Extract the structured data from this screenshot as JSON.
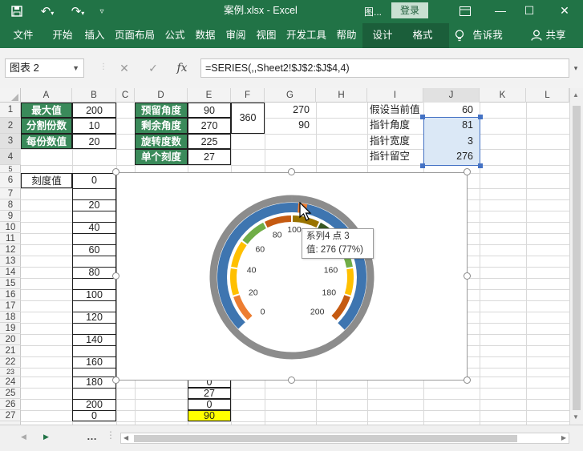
{
  "title_bar": {
    "document_title": "案例.xlsx  -  Excel",
    "picture_tools_tab": "图...",
    "login_label": "登录",
    "minimize_glyph": "—",
    "restore_glyph": "☐",
    "close_glyph": "✕"
  },
  "ribbon": {
    "tabs": [
      "文件",
      "开始",
      "插入",
      "页面布局",
      "公式",
      "数据",
      "审阅",
      "视图",
      "开发工具",
      "帮助"
    ],
    "context_tabs": [
      "设计",
      "格式"
    ],
    "tell_me": "告诉我",
    "share": "共享"
  },
  "formula_bar": {
    "name_box": "图表 2",
    "formula": "=SERIES(,,Sheet2!$J$2:$J$4,4)"
  },
  "columns": [
    "A",
    "B",
    "C",
    "D",
    "E",
    "F",
    "G",
    "H",
    "I",
    "J",
    "K",
    "L"
  ],
  "rows": [
    "1",
    "2",
    "3",
    "4",
    "5",
    "6",
    "7",
    "8",
    "9",
    "10",
    "11",
    "12",
    "13",
    "14",
    "15",
    "16",
    "17",
    "18",
    "19",
    "20",
    "21",
    "22",
    "23",
    "24",
    "25",
    "26",
    "27"
  ],
  "params": {
    "labels": [
      "最大值",
      "分割份数",
      "每份数值"
    ],
    "values": [
      "200",
      "10",
      "20"
    ]
  },
  "angles": {
    "labels": [
      "预留角度",
      "剩余角度",
      "旋转度数",
      "单个刻度"
    ],
    "values": [
      "90",
      "270",
      "225",
      "27"
    ]
  },
  "f1_value": "360",
  "g_values": [
    "270",
    "90"
  ],
  "pointer": {
    "labels": [
      "假设当前值",
      "指针角度",
      "指针宽度",
      "指针留空"
    ],
    "values": [
      "60",
      "81",
      "3",
      "276"
    ]
  },
  "scale": {
    "header": "刻度值",
    "values": [
      "0",
      "20",
      "40",
      "60",
      "80",
      "100",
      "120",
      "140",
      "160",
      "180",
      "200",
      "0"
    ]
  },
  "e_bottom": [
    "0",
    "27",
    "0",
    "90"
  ],
  "chart": {
    "tick_labels": [
      "0",
      "20",
      "40",
      "60",
      "80",
      "100",
      "160",
      "180",
      "200"
    ],
    "tooltip_line1": "系列4 点 3",
    "tooltip_line2": "值: 276 (77%)"
  },
  "colors": {
    "excel_green": "#217346",
    "table_green": "#3a8a5a",
    "ring_gray": "#8c8c8c",
    "ring_blue": "#3e75b0",
    "seg_orange": "#ed7d31",
    "seg_yellow": "#ffc000",
    "seg_green": "#70ad47",
    "seg_darkorange": "#c55a11",
    "seg_olive": "#997300",
    "seg_darkgreen": "#385723",
    "highlight_yellow": "#ffff00"
  }
}
